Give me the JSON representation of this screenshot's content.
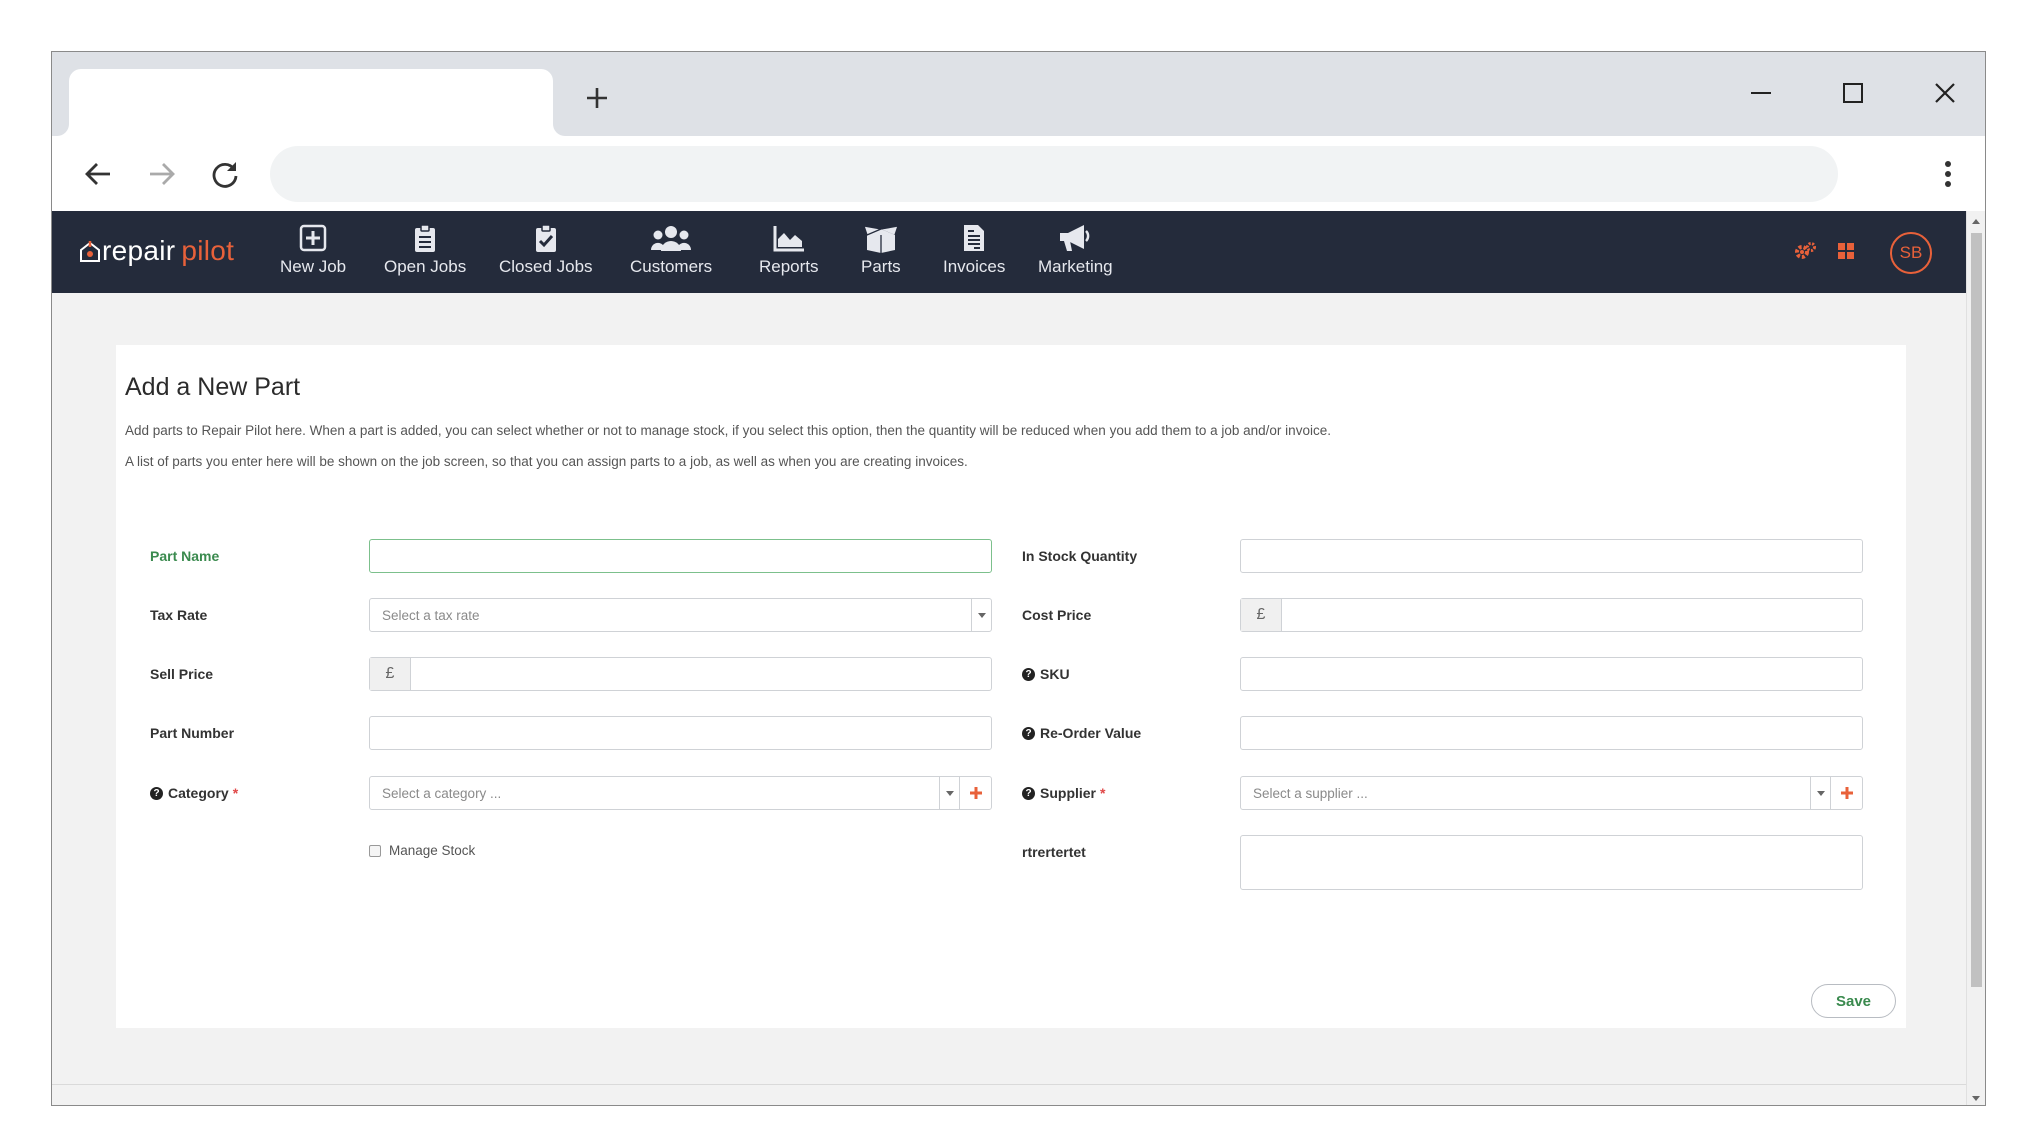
{
  "browser": {
    "new_tab_icon": "plus-icon",
    "back_icon": "arrow-left-icon",
    "forward_icon": "arrow-right-icon",
    "reload_icon": "reload-icon",
    "address": "",
    "window_controls": [
      "minimize-icon",
      "maximize-icon",
      "close-icon"
    ]
  },
  "app": {
    "logo": {
      "part1": "repair",
      "part2": "pilot"
    },
    "nav": [
      {
        "label": "New Job",
        "icon": "plus-square-icon"
      },
      {
        "label": "Open Jobs",
        "icon": "clipboard-list-icon"
      },
      {
        "label": "Closed Jobs",
        "icon": "clipboard-check-icon"
      },
      {
        "label": "Customers",
        "icon": "users-icon"
      },
      {
        "label": "Reports",
        "icon": "area-chart-icon"
      },
      {
        "label": "Parts",
        "icon": "box-open-icon"
      },
      {
        "label": "Invoices",
        "icon": "file-invoice-icon"
      },
      {
        "label": "Marketing",
        "icon": "megaphone-icon"
      }
    ],
    "right_icons": [
      "cogs-icon",
      "grid-icon"
    ],
    "user_initials": "SB",
    "accent": "#e8613a",
    "nav_bg": "#242b3b"
  },
  "page": {
    "title": "Add a New Part",
    "desc1": "Add parts to Repair Pilot here. When a part is added, you can select whether or not to manage stock, if you select this option, then the quantity will be reduced when you add them to a job and/or invoice.",
    "desc2": "A list of parts you enter here will be shown on the job screen, so that you can assign parts to a job, as well as when you are creating invoices.",
    "form": {
      "part_name": {
        "label": "Part Name",
        "value": ""
      },
      "tax_rate": {
        "label": "Tax Rate",
        "placeholder": "Select a tax rate"
      },
      "sell_price": {
        "label": "Sell Price",
        "currency": "£",
        "value": ""
      },
      "part_number": {
        "label": "Part Number",
        "value": ""
      },
      "category": {
        "label": "Category",
        "required": "*",
        "placeholder": "Select a category ..."
      },
      "manage_stock": {
        "label": "Manage Stock",
        "checked": false
      },
      "in_stock_quantity": {
        "label": "In Stock Quantity",
        "value": ""
      },
      "cost_price": {
        "label": "Cost Price",
        "currency": "£",
        "value": ""
      },
      "sku": {
        "label": "SKU",
        "value": ""
      },
      "reorder_value": {
        "label": "Re-Order Value",
        "value": ""
      },
      "supplier": {
        "label": "Supplier",
        "required": "*",
        "placeholder": "Select a supplier ..."
      },
      "custom_field": {
        "label": "rtrertertet",
        "value": ""
      }
    },
    "save_label": "Save"
  }
}
